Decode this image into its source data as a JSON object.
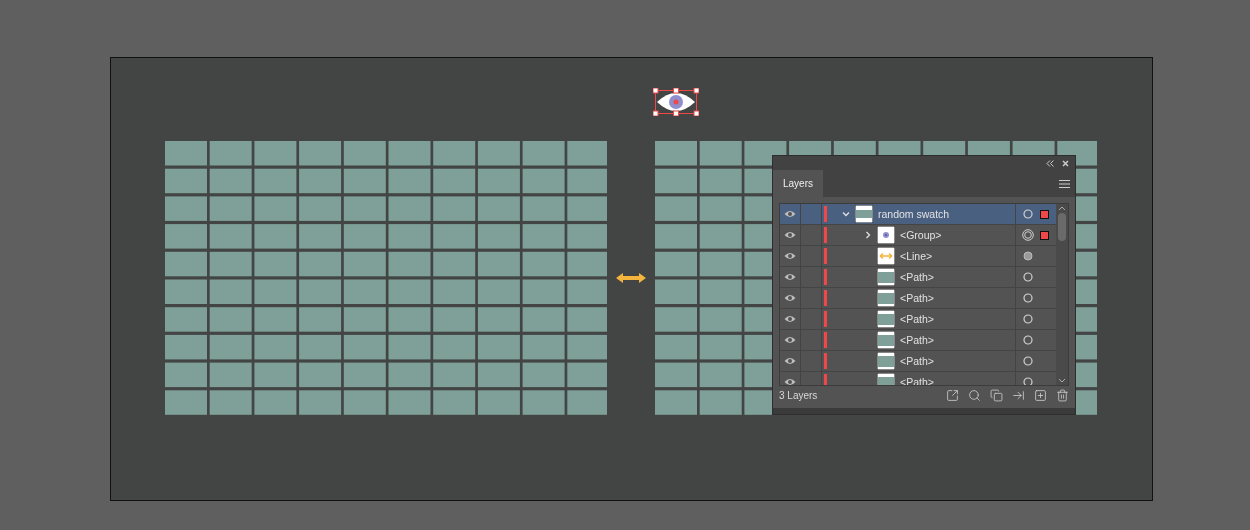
{
  "panel": {
    "tabs": [
      {
        "label": "Layers",
        "selected": true
      }
    ],
    "layers": [
      {
        "name": "random swatch",
        "visible": true,
        "selected": true,
        "expanded": true,
        "thumbnail": {
          "kind": "swatch"
        },
        "target": {
          "kind": "ring"
        },
        "marked": true,
        "children": [
          {
            "name": "<Group>",
            "visible": true,
            "selected": false,
            "expanded": false,
            "thumbnail": {
              "kind": "eye"
            },
            "target": {
              "kind": "double"
            },
            "marked": true
          },
          {
            "name": "<Line>",
            "visible": true,
            "selected": false,
            "thumbnail": {
              "kind": "line"
            },
            "target": {
              "kind": "filled"
            },
            "marked": false
          },
          {
            "name": "<Path>",
            "visible": true,
            "selected": false,
            "thumbnail": {
              "kind": "path"
            },
            "target": {
              "kind": "ring"
            },
            "marked": false
          },
          {
            "name": "<Path>",
            "visible": true,
            "selected": false,
            "thumbnail": {
              "kind": "path"
            },
            "target": {
              "kind": "ring"
            },
            "marked": false
          },
          {
            "name": "<Path>",
            "visible": true,
            "selected": false,
            "thumbnail": {
              "kind": "path"
            },
            "target": {
              "kind": "ring"
            },
            "marked": false
          },
          {
            "name": "<Path>",
            "visible": true,
            "selected": false,
            "thumbnail": {
              "kind": "path"
            },
            "target": {
              "kind": "ring"
            },
            "marked": false
          },
          {
            "name": "<Path>",
            "visible": true,
            "selected": false,
            "thumbnail": {
              "kind": "path"
            },
            "target": {
              "kind": "ring"
            },
            "marked": false
          },
          {
            "name": "<Path>",
            "visible": true,
            "selected": false,
            "thumbnail": {
              "kind": "path"
            },
            "target": {
              "kind": "ring"
            },
            "marked": false
          }
        ]
      }
    ],
    "footer": "3 Layers"
  }
}
